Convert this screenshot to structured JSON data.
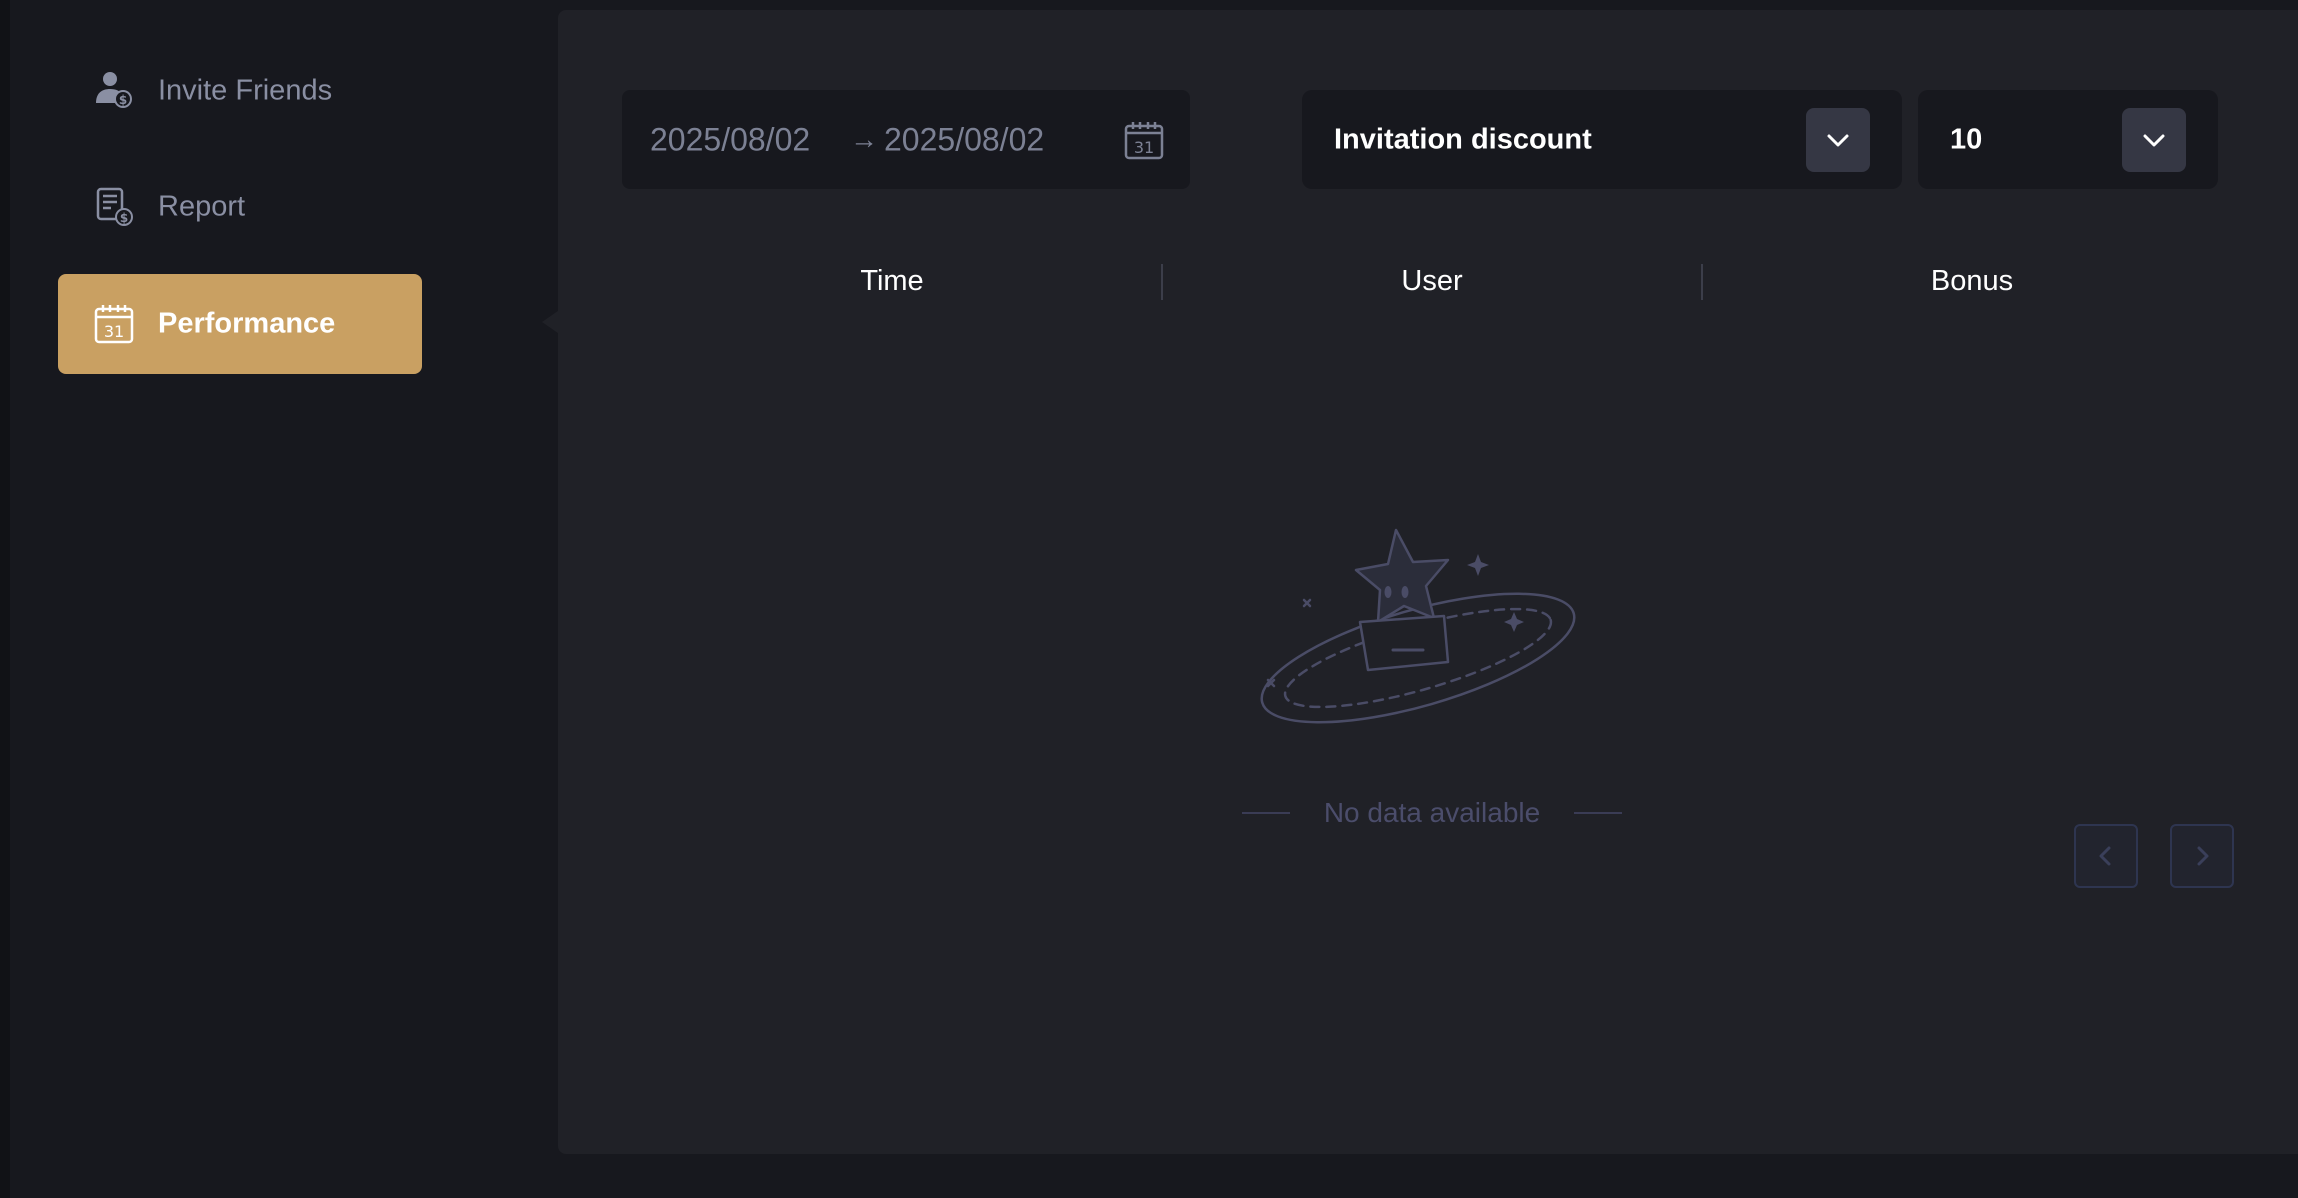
{
  "sidebar": {
    "items": [
      {
        "label": "Invite Friends",
        "icon": "users-coin-icon",
        "active": false
      },
      {
        "label": "Report",
        "icon": "receipt-coin-icon",
        "active": false
      },
      {
        "label": "Performance",
        "icon": "calendar-icon",
        "active": true
      }
    ]
  },
  "filters": {
    "date_start": "2025/08/02",
    "date_arrow": "→",
    "date_end": "2025/08/02",
    "calendar_day": "31",
    "type_select": {
      "value": "Invitation discount"
    },
    "page_size_select": {
      "value": "10"
    }
  },
  "table": {
    "columns": [
      "Time",
      "User",
      "Bonus"
    ],
    "empty_text": "No data available"
  },
  "colors": {
    "background": "#17181e",
    "panel": "#202127",
    "accent": "#c9a062",
    "muted_text": "#8a8fa3",
    "empty_text": "#4b4d6b"
  }
}
